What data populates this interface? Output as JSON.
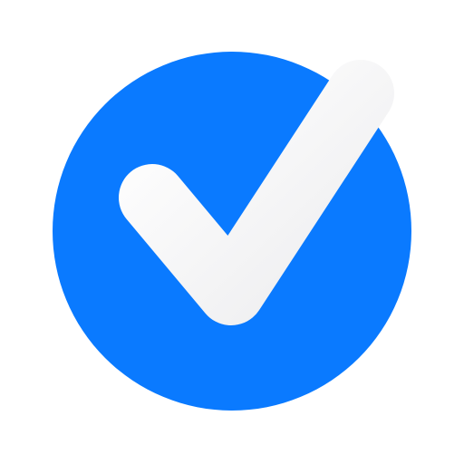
{
  "icon": {
    "name": "checkmark-circle-icon",
    "circle_color": "#0A7AFF",
    "check_color": "#F4F4F5",
    "background_color": "#FFFFFF"
  }
}
